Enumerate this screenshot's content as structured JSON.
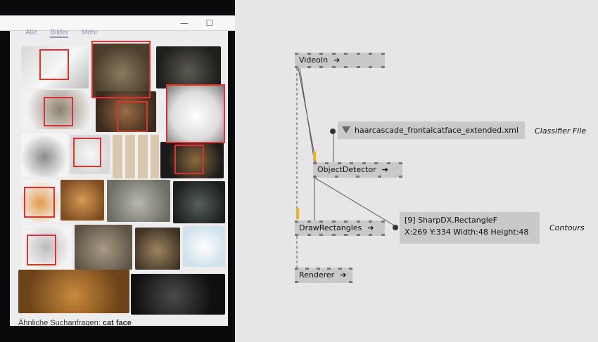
{
  "video_window": {
    "minimize_glyph": "—",
    "maximize_glyph": "☐",
    "tabs": [
      "Alle",
      "Bilder",
      "Mehr"
    ],
    "related_prefix": "Ähnliche Suchanfragen: ",
    "related_query": "cat face"
  },
  "nodes": {
    "videoin": {
      "name": "VideoIn",
      "arrow": "➔"
    },
    "objectdetector": {
      "name": "ObjectDetector",
      "arrow": "➔"
    },
    "drawrectangles": {
      "name": "DrawRectangles",
      "arrow": "➔"
    },
    "renderer": {
      "name": "Renderer",
      "arrow": "➔"
    }
  },
  "classifier": {
    "value": "haarcascade_frontalcatface_extended.xml",
    "note": "Classifier File"
  },
  "contours": {
    "line1": "[9] SharpDX.RectangleF",
    "line2": "X:269 Y:334 Width:48 Height:48",
    "note": "Contours"
  },
  "colors": {
    "node_fill": "#c9c9c9",
    "canvas": "#e6e6e6",
    "detection": "#e03030",
    "active_pin": "#f0b020"
  }
}
